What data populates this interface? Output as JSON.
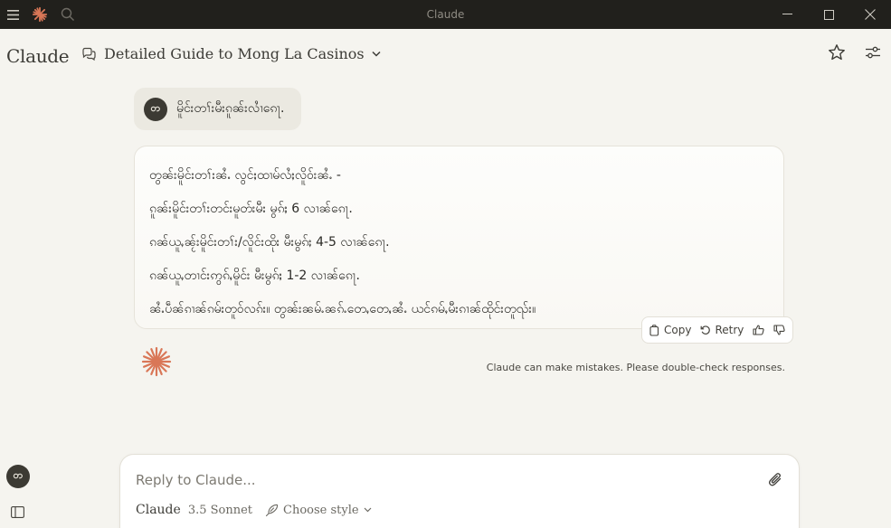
{
  "window": {
    "title": "Claude",
    "controls": {
      "menu": "hamburger-icon",
      "logo": "claude-spark-icon",
      "search": "search-icon"
    }
  },
  "header": {
    "brand": "Claude",
    "conversation_title": "Detailed Guide to Mong La Casinos",
    "actions": [
      "star-icon",
      "settings-sliders-icon"
    ]
  },
  "user": {
    "initial": "တ"
  },
  "messages": {
    "user": "မိူင်းတၢ်းမီးၵူၼ်းလၢႆၵေႃ.",
    "assistant": [
      "တွၼ်းမိူင်းတၢ်းၼႆႉ လွင်ႈထၢမ်လႆႈလိူဝ်းၼႆႉ -",
      "ၵူၼ်းမိူင်းတၢ်းတင်းမူတ်းမီး မွၵ်ႈ 6 လၢၼ်ၵေႃ.",
      "ၵၼ်ယူႇၼႂ်းမိူင်းတၢ်း/လိူင်းထိုး မီးမွၵ်ႈ 4-5 လၢၼ်ၵေႃ.",
      "ၵၼ်ယူႇတၢင်းဢွၵ်ႇမိူင်း မီးမွၵ်ႈ 1-2 လၢၼ်ၵေႃ.",
      "ၼႆႉပဵၼ်ၵၢၼ်ၵမ်းတူဝ်လၵ်း။ တွၼ်းၼမ်ႉၼၵ်ႉတေႇတေႇၼႆႉ ယင်ၵမ်ႇမီးၵၢၼ်ထိုင်းတူၺ်း။"
    ]
  },
  "message_actions": {
    "copy": "Copy",
    "retry": "Retry"
  },
  "disclaimer": "Claude can make mistakes. Please double-check responses.",
  "composer": {
    "placeholder": "Reply to Claude...",
    "model": "Claude",
    "model_version": "3.5 Sonnet",
    "style_label": "Choose style"
  },
  "colors": {
    "accent": "#d97757",
    "titlebar": "#21201c",
    "background": "#f5f4ef"
  }
}
